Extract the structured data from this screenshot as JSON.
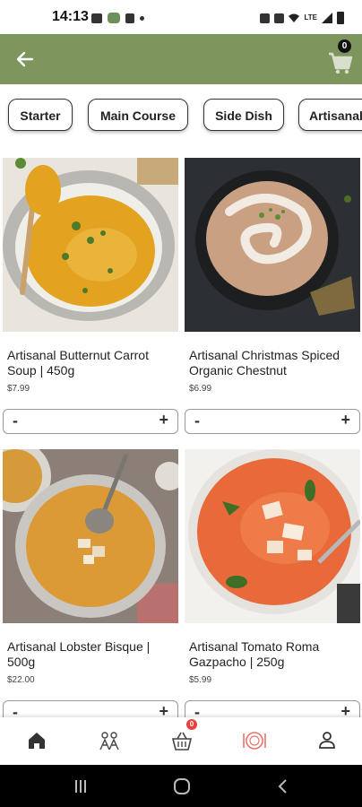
{
  "status_bar": {
    "time": "14:13",
    "network": "LTE"
  },
  "header": {
    "cart_count": "0"
  },
  "categories": [
    "Starter",
    "Main Course",
    "Side Dish",
    "Artisanal"
  ],
  "products": [
    {
      "name": "Artisanal Butternut Carrot Soup | 450g",
      "price": "$7.99",
      "minus": "-",
      "plus": "+"
    },
    {
      "name": "Artisanal Christmas Spiced Organic Chestnut",
      "price": "$6.99",
      "minus": "-",
      "plus": "+"
    },
    {
      "name": "Artisanal Lobster Bisque | 500g",
      "price": "$22.00",
      "minus": "-",
      "plus": "+"
    },
    {
      "name": "Artisanal Tomato Roma Gazpacho | 250g",
      "price": "$5.99",
      "minus": "-",
      "plus": "+"
    }
  ],
  "bottom_nav": {
    "items": [
      "home-icon",
      "chef-icon",
      "basket-icon",
      "dish-icon",
      "profile-icon"
    ],
    "basket_badge": "0",
    "active_index": 3
  },
  "colors": {
    "app_bar": "#7f955e",
    "active_nav": "#e8756a",
    "badge": "#e8403f"
  }
}
